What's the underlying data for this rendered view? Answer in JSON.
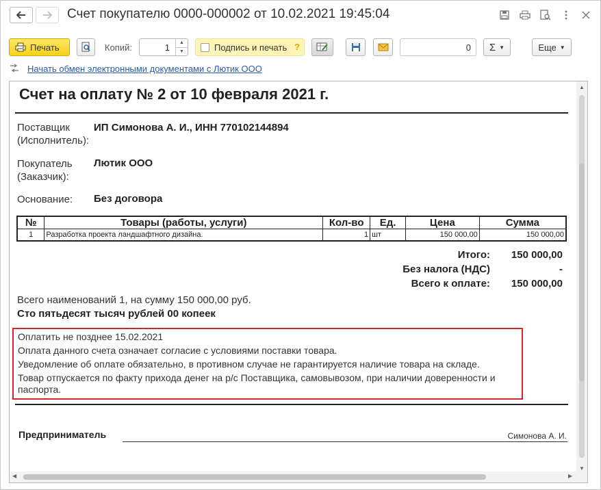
{
  "window": {
    "title": "Счет покупателю 0000-000002 от 10.02.2021 19:45:04",
    "back_glyph": "🡐",
    "forward_glyph": "🡒",
    "icons": [
      "save-icon",
      "printer-icon",
      "search-document-icon",
      "more-vertical-icon",
      "close-icon"
    ]
  },
  "toolbar": {
    "print_label": "Печать",
    "copies_label": "Копий:",
    "copies_value": "1",
    "sign_print_label": "Подпись и печать",
    "sign_print_help": "?",
    "sum_value": "0",
    "sigma_label": "Σ",
    "more_label": "Еще"
  },
  "exchange": {
    "link_text": "Начать обмен электронными документами с Лютик ООО"
  },
  "document": {
    "title": "Счет на оплату № 2 от 10 февраля 2021 г.",
    "supplier_label_1": "Поставщик",
    "supplier_label_2": "(Исполнитель):",
    "supplier_value": "ИП Симонова А. И., ИНН 770102144894",
    "buyer_label_1": "Покупатель",
    "buyer_label_2": "(Заказчик):",
    "buyer_value": "Лютик ООО",
    "basis_label": "Основание:",
    "basis_value": "Без договора",
    "table": {
      "headers": [
        "№",
        "Товары (работы, услуги)",
        "Кол-во",
        "Ед.",
        "Цена",
        "Сумма"
      ],
      "rows": [
        {
          "num": "1",
          "name": "Разработка проекта ландшафтного дизайна.",
          "qty": "1",
          "unit": "шт",
          "price": "150 000,00",
          "sum": "150 000,00"
        }
      ]
    },
    "totals": {
      "total_label": "Итого:",
      "total_value": "150 000,00",
      "vat_label": "Без налога (НДС)",
      "vat_value": "-",
      "due_label": "Всего к оплате:",
      "due_value": "150 000,00"
    },
    "summary_line": "Всего наименований 1, на сумму 150 000,00 руб.",
    "summary_words": "Сто пятьдесят тысяч рублей 00 копеек",
    "terms": [
      "Оплатить не позднее 15.02.2021",
      "Оплата данного счета означает согласие с условиями поставки товара.",
      "Уведомление об оплате обязательно, в противном случае не гарантируется наличие товара на складе.",
      "Товар отпускается по факту прихода денег на р/с Поставщика, самовывозом, при наличии доверенности и паспорта."
    ],
    "signature_label": "Предприниматель",
    "signature_name": "Симонова А. И."
  },
  "colors": {
    "print_button": "#f5d21a",
    "sign_highlight": "#fdf4b5",
    "link": "#2a5aa6",
    "terms_border": "#d8232a"
  }
}
